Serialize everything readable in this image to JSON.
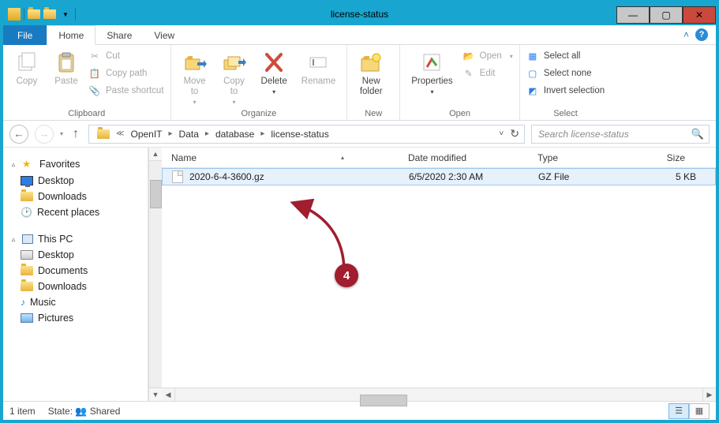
{
  "window": {
    "title": "license-status"
  },
  "tabs": {
    "file": "File",
    "home": "Home",
    "share": "Share",
    "view": "View"
  },
  "ribbon": {
    "clipboard": {
      "copy": "Copy",
      "paste": "Paste",
      "cut": "Cut",
      "copy_path": "Copy path",
      "paste_shortcut": "Paste shortcut",
      "label": "Clipboard"
    },
    "organize": {
      "move_to": "Move\nto",
      "copy_to": "Copy\nto",
      "delete": "Delete",
      "rename": "Rename",
      "label": "Organize"
    },
    "new": {
      "new_folder": "New\nfolder",
      "label": "New"
    },
    "open": {
      "properties": "Properties",
      "open": "Open",
      "edit": "Edit",
      "label": "Open"
    },
    "select": {
      "select_all": "Select all",
      "select_none": "Select none",
      "invert": "Invert selection",
      "label": "Select"
    }
  },
  "breadcrumb": {
    "parts": [
      "OpenIT",
      "Data",
      "database",
      "license-status"
    ]
  },
  "search": {
    "placeholder": "Search license-status"
  },
  "navpane": {
    "favorites": "Favorites",
    "fav_items": [
      "Desktop",
      "Downloads",
      "Recent places"
    ],
    "thispc": "This PC",
    "pc_items": [
      "Desktop",
      "Documents",
      "Downloads",
      "Music",
      "Pictures"
    ]
  },
  "columns": {
    "name": "Name",
    "date": "Date modified",
    "type": "Type",
    "size": "Size"
  },
  "files": [
    {
      "name": "2020-6-4-3600.gz",
      "date": "6/5/2020 2:30 AM",
      "type": "GZ File",
      "size": "5 KB"
    }
  ],
  "status": {
    "items": "1 item",
    "state_label": "State:",
    "state_value": "Shared"
  },
  "annotation": {
    "number": "4"
  }
}
